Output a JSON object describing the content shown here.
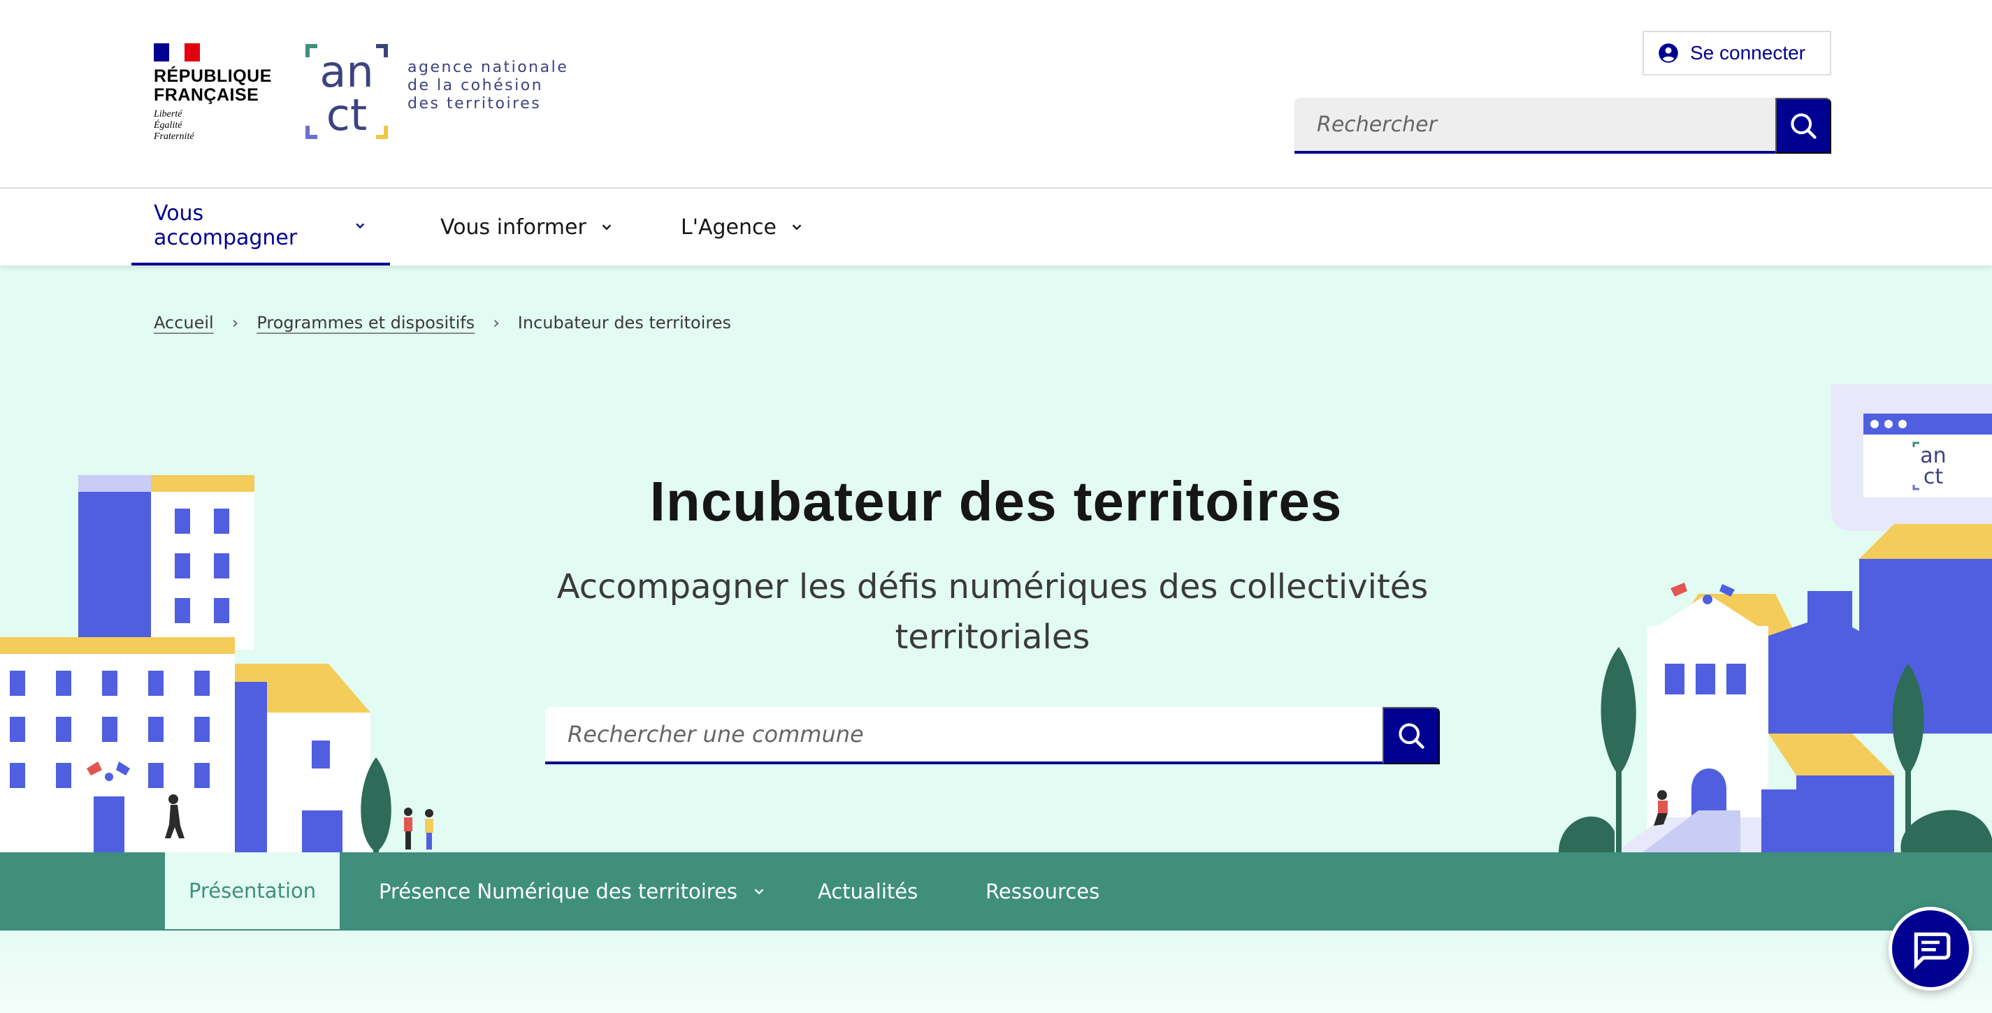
{
  "header": {
    "rf_name_line1": "RÉPUBLIQUE",
    "rf_name_line2": "FRANÇAISE",
    "rf_motto": [
      "Liberté",
      "Égalité",
      "Fraternité"
    ],
    "anct_logo_text": "an ct",
    "anct_name": [
      "agence nationale",
      "de la cohésion",
      "des territoires"
    ],
    "login_label": "Se connecter",
    "search_placeholder": "Rechercher"
  },
  "nav": {
    "items": [
      {
        "label": "Vous accompagner",
        "active": true
      },
      {
        "label": "Vous informer",
        "active": false
      },
      {
        "label": "L'Agence",
        "active": false
      }
    ]
  },
  "breadcrumb": {
    "items": [
      "Accueil",
      "Programmes et dispositifs"
    ],
    "current": "Incubateur des territoires"
  },
  "hero": {
    "title": "Incubateur des territoires",
    "subtitle_line1": "Accompagner les défis numériques des collectivités",
    "subtitle_line2": "territoriales",
    "search_placeholder": "Rechercher une commune"
  },
  "subnav": {
    "items": [
      {
        "label": "Présentation",
        "active": true
      },
      {
        "label": "Présence Numérique des territoires",
        "active": false
      },
      {
        "label": "Actualités",
        "active": false
      },
      {
        "label": "Ressources",
        "active": false
      }
    ]
  },
  "icons": {
    "login": "user-circle-icon",
    "search": "search-icon",
    "chevron": "chevron-down-icon",
    "chat": "chat-icon"
  },
  "colors": {
    "primary": "#000091",
    "hero_bg": "#e2fbf3",
    "subnav_bg": "#3f8f7c",
    "flag_blue": "#000091",
    "flag_red": "#e1000f"
  }
}
